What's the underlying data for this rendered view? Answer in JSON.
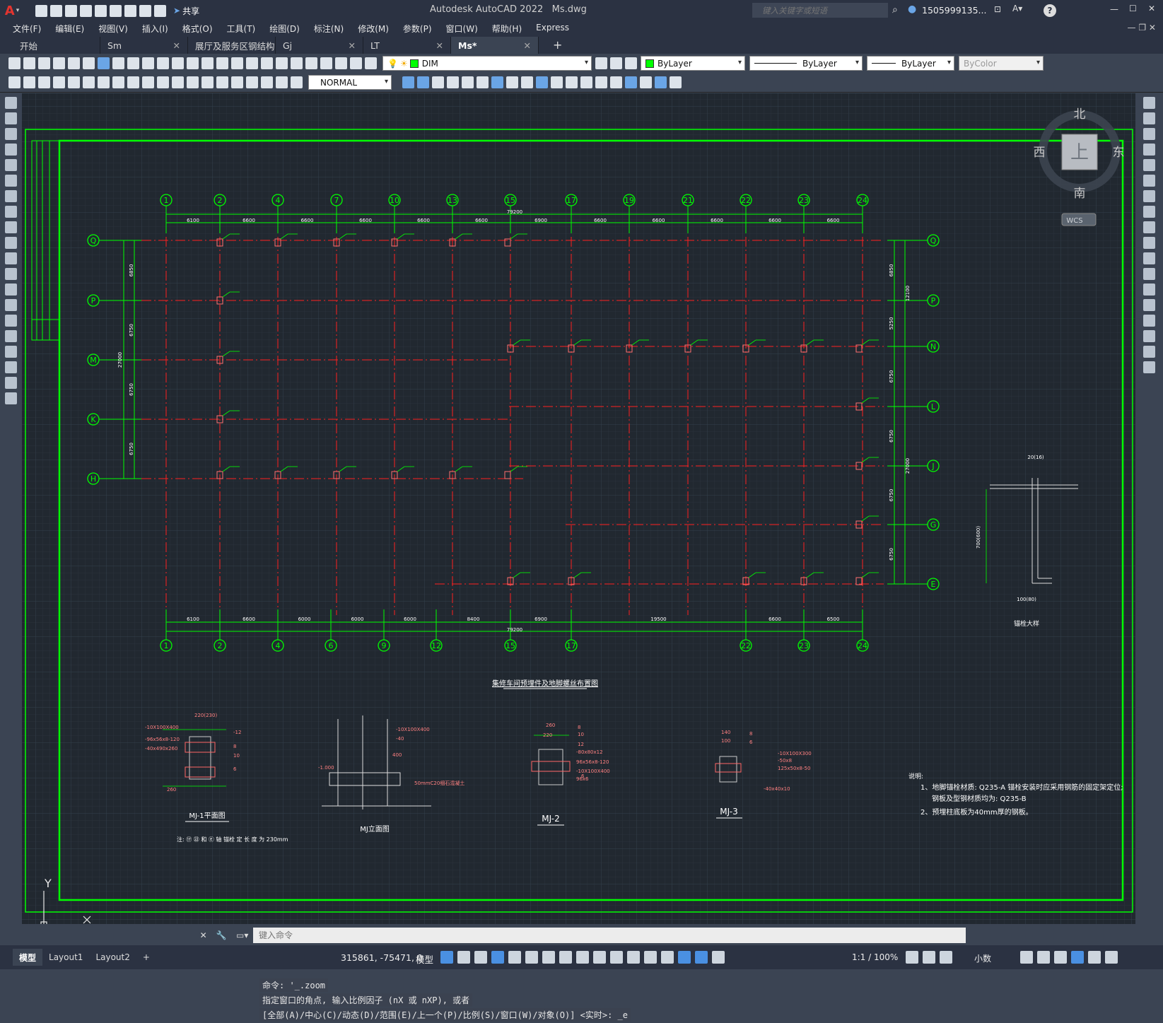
{
  "window": {
    "app_title": "Autodesk AutoCAD 2022",
    "file_name": "Ms.dwg",
    "share_label": "共享",
    "search_placeholder": "键入关键字或短语",
    "user_name": "1505999135...",
    "minimize": "—",
    "maximize": "☐",
    "close": "✕"
  },
  "menu": [
    "文件(F)",
    "编辑(E)",
    "视图(V)",
    "插入(I)",
    "格式(O)",
    "工具(T)",
    "绘图(D)",
    "标注(N)",
    "修改(M)",
    "参数(P)",
    "窗口(W)",
    "帮助(H)",
    "Express"
  ],
  "tabs": [
    {
      "label": "开始",
      "close": ""
    },
    {
      "label": "Sm",
      "close": "✕"
    },
    {
      "label": "展厅及服务区钢结构施工图",
      "close": "✕"
    },
    {
      "label": "Gj",
      "close": "✕"
    },
    {
      "label": "LT",
      "close": "✕"
    },
    {
      "label": "Ms*",
      "close": "✕"
    }
  ],
  "new_tab": "+",
  "toolbar": {
    "layer": "DIM",
    "color": "ByLayer",
    "color_swatch": "#00ff00",
    "linetype": "ByLayer",
    "lineweight": "ByLayer",
    "plotstyle": "ByColor",
    "textstyle": "NORMAL"
  },
  "viewcube": {
    "north": "北",
    "south": "南",
    "east": "东",
    "west": "西",
    "top": "上",
    "wcs": "WCS"
  },
  "drawing": {
    "grid_top": [
      "1",
      "2",
      "4",
      "7",
      "10",
      "13",
      "15",
      "17",
      "19",
      "21",
      "22",
      "23",
      "24"
    ],
    "grid_bottom": [
      "1",
      "2",
      "4",
      "6",
      "9",
      "12",
      "15",
      "17",
      "22",
      "23",
      "24"
    ],
    "grid_left": [
      "Q",
      "P",
      "M",
      "K",
      "H"
    ],
    "grid_right": [
      "Q",
      "P",
      "N",
      "L",
      "J",
      "G",
      "E"
    ],
    "dims_top": [
      "6100",
      "6600",
      "6600",
      "6600",
      "6600",
      "6600",
      "6900",
      "6600",
      "6600",
      "6600",
      "6600",
      "6600"
    ],
    "dims_top_total": "79200",
    "dims_bottom": [
      "6100",
      "6600",
      "6000",
      "6000",
      "6000",
      "8400",
      "6900",
      "19500",
      "6600",
      "6500"
    ],
    "dims_bottom_total": "79200",
    "dims_left": [
      "6850",
      "6750",
      "6750",
      "6750"
    ],
    "dims_left_total": "27000",
    "dims_right": [
      "6850",
      "5250",
      "6750",
      "6750",
      "6750",
      "6750"
    ],
    "dims_right_total": [
      "12100",
      "27000"
    ],
    "plan_title": "集修车间预埋件及地脚螺丝布置图",
    "detail_titles": [
      "MJ-1平面图",
      "MJ立面图",
      "MJ-2",
      "MJ-3"
    ],
    "anchor_title": "锚栓大样",
    "anchor_dims": [
      "20(16)",
      "700(600)",
      "100(80)"
    ],
    "mj1_note": "注: ⑰ ㉒ 和 Ⓔ 轴 锚栓 定 长 度 为 230mm",
    "mj1_callouts": [
      "-10X100X400",
      "-96x56x8-120",
      "-40x490x260",
      "-12",
      "8",
      "10",
      "6",
      "260",
      "220(230)"
    ],
    "mj_elev_callouts": [
      "-10X100X400",
      "-40",
      "-1.000",
      "400",
      "50mmC20细石混凝土"
    ],
    "mj2_callouts": [
      "260",
      "220",
      "8",
      "10",
      "12",
      "6",
      "-80x80x12",
      "96x56x8-120",
      "-10X100X400",
      "96x6"
    ],
    "mj3_callouts": [
      "140",
      "100",
      "8",
      "6",
      "-10X100X300",
      "-50x8",
      "125x50x8-50",
      "-40x40x10"
    ],
    "notes_title": "说明:",
    "notes": [
      "1、地脚锚栓材质: Q235-A 锚栓安装时应采用钢筋的固定架定位;",
      "钢板及型钢材质均为: Q235-B",
      "2、预埋柱底板为40mm厚的钢板。"
    ],
    "ucs_y": "Y",
    "ucs_x": "X"
  },
  "command": {
    "history": [
      "命令: '_.zoom",
      "指定窗口的角点, 输入比例因子 (nX 或 nXP), 或者",
      "[全部(A)/中心(C)/动态(D)/范围(E)/上一个(P)/比例(S)/窗口(W)/对象(O)] <实时>: _e"
    ],
    "placeholder": "键入命令"
  },
  "status": {
    "tabs": [
      "模型",
      "Layout1",
      "Layout2"
    ],
    "add": "+",
    "coords": "315861, -75471, 0",
    "mode": "模型",
    "scale": "1:1 / 100%",
    "units": "小数"
  }
}
